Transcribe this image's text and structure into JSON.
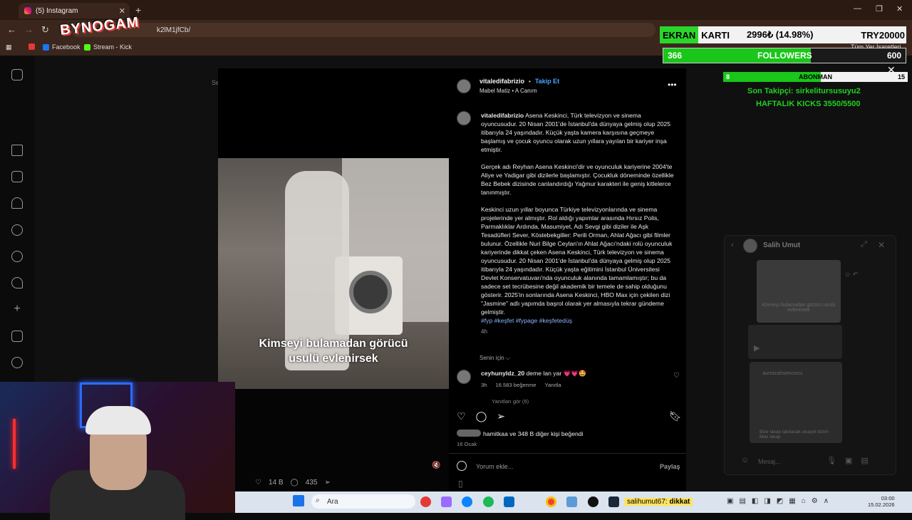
{
  "browser": {
    "tab_title": "(5) Instagram",
    "new_tab": "+",
    "url": "k2lM1jfCb/",
    "bookmarks": [
      {
        "label": "Facebook"
      },
      {
        "label": "Stream - Kick"
      }
    ],
    "bookmarks_right": "Tüm Yer İşaretleri",
    "overlay_logo": "BYNOGAM"
  },
  "post": {
    "username": "vitaledifabrizio",
    "follow_label": "Takip Et",
    "sub_line": "Mabel Matiz • A Canım",
    "caption_user": "vitaledifabrizio",
    "paragraphs": [
      "Asena Keskinci, Türk televizyon ve sinema oyuncusudur. 20 Nisan 2001'de İstanbul'da dünyaya gelmiş olup 2025 itibarıyla 24 yaşındadır. Küçük yaşta kamera karşısına geçmeye başlamış ve çocuk oyuncu olarak uzun yıllara yayılan bir kariyer inşa etmiştir.",
      "Gerçek adı Reyhan Asena Keskinci'dir ve oyunculuk kariyerine 2004'te Aliye ve Yadigar gibi dizilerle başlamıştır. Çocukluk döneminde özellikle Bez Bebek dizisinde canlandırdığı Yağmur karakteri ile geniş kitlelerce tanınmıştır.",
      "Keskinci uzun yıllar boyunca Türkiye televizyonlarında ve sinema projelerinde yer almıştır. Rol aldığı yapımlar arasında Hırsız Polis, Parmaklıklar Ardında, Masumiyet, Adı Sevgi gibi diziler ile Aşk Tesadüfleri Sever, Köstebekgiller: Perili Orman, Ahlat Ağacı gibi filmler bulunur. Özellikle Nuri Bilge Ceylan'ın Ahlat Ağacı'ndaki rolü oyunculuk kariyerinde dikkat çeken Asena Keskinci, Türk televizyon ve sinema oyuncusudur. 20 Nisan 2001'de İstanbul'da dünyaya gelmiş olup 2025 itibarıyla 24 yaşındadır. Küçük yaşta eğitimini İstanbul Üniversitesi Devlet Konservatuvarı'nda oyunculuk alanında tamamlamıştır; bu da sadece set tecrübesine değil akademik bir temele de sahip olduğunu gösterir. 2025'in sonlarında Asena Keskinci, HBO Max için çekilen dizi \"Jasmine\" adlı yapımda başrol olarak yer almasıyla tekrar gündeme gelmiştir."
    ],
    "hashtags": "#fyp #keşfet #fypage #keşfetedüş",
    "time": "4h",
    "senin_icin": "Senin için ⌵",
    "comment": {
      "user": "ceyhunyldz_20",
      "text": "deme lan yar 💗💗🤩",
      "time": "3h",
      "likes": "16.583 beğenme",
      "reply": "Yanıtla",
      "view_replies": "Yanıtları gör (6)"
    },
    "liked_by": "hamitkaa ve 348 B diğer kişi beğendi",
    "date": "16 Ocak",
    "comment_placeholder": "Yorum ekle...",
    "share_label": "Paylaş"
  },
  "video": {
    "caption_line1": "Kimseyi bulamadan görücü",
    "caption_line2": "usulü evlenirsek",
    "left_partial": "Se",
    "likes": "14 B",
    "comments": "435"
  },
  "overlays": {
    "ekran_label": "EKRAN",
    "karti_label": "KARTI",
    "price": "2996₺ (14.98%)",
    "goal": "TRY20000",
    "followers_current": "366",
    "followers_label": "FOLLOWERS",
    "followers_goal": "600",
    "followers_progress": 0.61,
    "abonman_current": "8",
    "abonman_label": "ABONMAN",
    "abonman_goal": "15",
    "abonman_progress": 0.53,
    "last_follower": "Son Takipçi: sirkelitursusuyu2",
    "weekly_kicks": "HAFTALIK KICKS 3550/5500"
  },
  "dm": {
    "name": "Salih Umut",
    "thumb_caption": "Kimseyi bulamadan görücü usulü evlenirsek",
    "second_user": "aumizahsencocu",
    "second_caption": "Bize lakap takılacak olsaydı bizim Max lakap",
    "message_placeholder": "Mesaj..."
  },
  "taskbar": {
    "search": "Ara",
    "kick_user": "salihumut67",
    "kick_msg": "dikkat",
    "time": "03:00",
    "date": "15.02.2026"
  },
  "colors": {
    "accent_green": "#19c619",
    "link_blue": "#4da3ff",
    "ig_bg": "#000000"
  }
}
